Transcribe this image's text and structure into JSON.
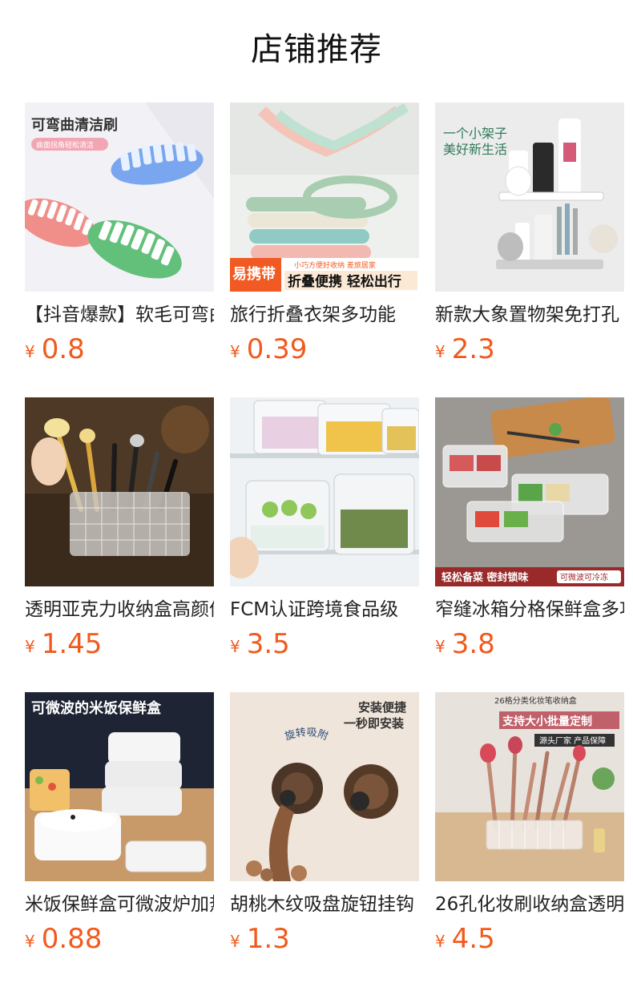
{
  "header": {
    "title": "店铺推荐"
  },
  "products": [
    {
      "title": "【抖音爆款】软毛可弯曲清洁刷",
      "currency": "¥",
      "price": "0.8",
      "image_text": {
        "headline": "可弯曲清洁刷",
        "tag": "曲面拐角轻松清洁"
      }
    },
    {
      "title": "旅行折叠衣架多功能",
      "currency": "¥",
      "price": "0.39",
      "image_text": {
        "badge": "易携带",
        "small": "小巧方便好收纳 差旅居家",
        "big": "折叠便携 轻松出行"
      }
    },
    {
      "title": "新款大象置物架免打孔",
      "currency": "¥",
      "price": "2.3",
      "image_text": {
        "line1": "一个小架子",
        "line2": "美好新生活"
      }
    },
    {
      "title": "透明亚克力收纳盒高颜值化妆刷收纳",
      "currency": "¥",
      "price": "1.45",
      "image_text": {}
    },
    {
      "title": "FCM认证跨境食品级",
      "currency": "¥",
      "price": "3.5",
      "image_text": {}
    },
    {
      "title": "窄缝冰箱分格保鲜盒多功能",
      "currency": "¥",
      "price": "3.8",
      "image_text": {
        "banner": "轻松备菜 密封锁味",
        "tag": "可微波可冷冻"
      }
    },
    {
      "title": "米饭保鲜盒可微波炉加热",
      "currency": "¥",
      "price": "0.88",
      "image_text": {
        "headline": "可微波的米饭保鲜盒"
      }
    },
    {
      "title": "胡桃木纹吸盘旋钮挂钩",
      "currency": "¥",
      "price": "1.3",
      "image_text": {
        "line1": "安装便捷",
        "line2": "一秒即安装",
        "curve": "旋转吸附"
      }
    },
    {
      "title": "26孔化妆刷收纳盒透明",
      "currency": "¥",
      "price": "4.5",
      "image_text": {
        "small": "26格分类化妆笔收纳盒",
        "big": "支持大小批量定制",
        "tag": "源头厂家 产品保障"
      }
    }
  ]
}
